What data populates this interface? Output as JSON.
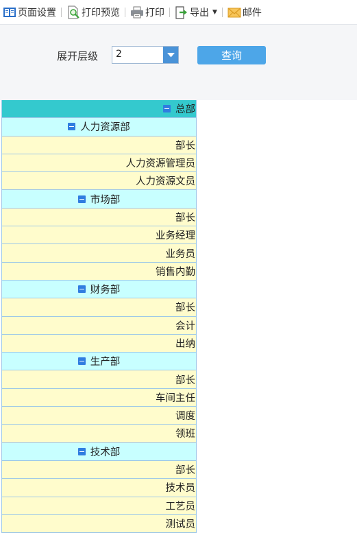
{
  "toolbar": {
    "page_setup": "页面设置",
    "print_preview": "打印预览",
    "print": "打印",
    "export": "导出",
    "mail": "邮件"
  },
  "params": {
    "label": "展开层级",
    "level_value": "2",
    "query_button": "查询"
  },
  "tree": {
    "root": "总部",
    "departments": [
      {
        "name": "人力资源部",
        "positions": [
          "部长",
          "人力资源管理员",
          "人力资源文员"
        ]
      },
      {
        "name": "市场部",
        "positions": [
          "部长",
          "业务经理",
          "业务员",
          "销售内勤"
        ]
      },
      {
        "name": "财务部",
        "positions": [
          "部长",
          "会计",
          "出纳"
        ]
      },
      {
        "name": "生产部",
        "positions": [
          "部长",
          "车间主任",
          "调度",
          "领班"
        ]
      },
      {
        "name": "技术部",
        "positions": [
          "部长",
          "技术员",
          "工艺员",
          "测试员"
        ]
      }
    ]
  },
  "colors": {
    "root_row": "#34c9ce",
    "dept_row": "#c8ffff",
    "position_row": "#fffccc",
    "query_button": "#4da6e8",
    "collapse_icon": "#2f7de0"
  },
  "icons": [
    "page-setup-icon",
    "print-preview-icon",
    "printer-icon",
    "export-icon",
    "mail-icon",
    "collapse-icon",
    "dropdown-arrow-icon"
  ]
}
